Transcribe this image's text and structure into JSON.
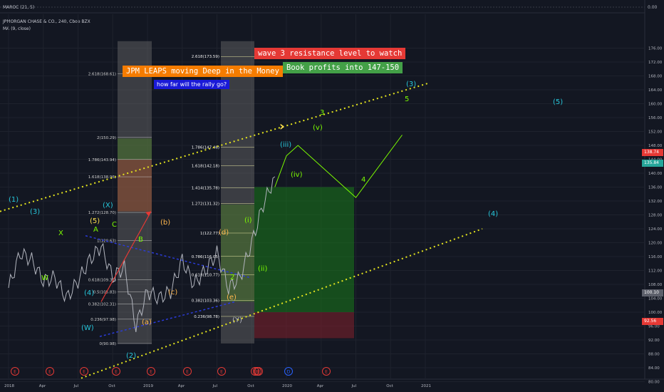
{
  "header": {
    "maroc": "MAROC (21, 5)",
    "symbol": "JPMORGAN CHASE & CO., 240, Cboe BZX",
    "ma": "MA (9, close)"
  },
  "annotations": {
    "wave3": "wave 3 resistance level to watch",
    "book": "Book profits into 147-150",
    "leaps": "JPM LEAPS moving Deep in the Money",
    "rally": "how far will the rally go?"
  },
  "price_tags": {
    "last": "138.74",
    "ma": "135.84",
    "stop": "100.10",
    "low": "92.56"
  },
  "colors": {
    "background": "#131722",
    "price_line": "#b2b5be",
    "channel": "#e6e61e",
    "wave_labels": "#26c6da",
    "projection": "#7cfc00",
    "long_position": "#1a7a1a",
    "stop_zone": "#7a1f2b"
  },
  "chart_data": {
    "type": "line",
    "title": "JPMORGAN CHASE & CO., 240, Cboe BZX",
    "indicator_title": "MAROC (21, 5)",
    "indicator_value_label": "0.00",
    "grid": true,
    "x_ticks": [
      "2018",
      "Apr",
      "Jul",
      "Oct",
      "2019",
      "Apr",
      "Jul",
      "Oct",
      "2020",
      "Apr",
      "Jul",
      "Oct",
      "2021"
    ],
    "y_ticks": [
      80,
      84,
      88,
      92,
      96,
      100,
      104,
      108,
      112,
      116,
      120,
      124,
      128,
      132,
      136,
      140,
      144,
      148,
      152,
      156,
      160,
      164,
      168,
      172,
      176
    ],
    "ylim": [
      78,
      178
    ],
    "series": [
      {
        "name": "price",
        "x": [
          "2018-01",
          "2018-02",
          "2018-03",
          "2018-04",
          "2018-05",
          "2018-06",
          "2018-07",
          "2018-08",
          "2018-09",
          "2018-10",
          "2018-11",
          "2018-12",
          "2019-01",
          "2019-02",
          "2019-03",
          "2019-04",
          "2019-05",
          "2019-06",
          "2019-07",
          "2019-08",
          "2019-09",
          "2019-10",
          "2019-11",
          "2019-12"
        ],
        "values": [
          107,
          117,
          115,
          109,
          110,
          104,
          109,
          115,
          119,
          110,
          113,
          96,
          106,
          104,
          106,
          115,
          108,
          112,
          117,
          107,
          110,
          120,
          131,
          139
        ]
      },
      {
        "name": "wave_projection",
        "x": [
          "2019-12",
          "2020-01",
          "2020-02",
          "2020-07",
          "2020-11"
        ],
        "values": [
          136,
          145,
          148,
          133,
          151
        ]
      }
    ],
    "fib_left": [
      "2.618(168.61)",
      "2(150.29)",
      "1.786(143.94)",
      "1.618(138.96)",
      "1.272(128.70)",
      "1(120.63)",
      "0.618(109.31)",
      "0.5(105.83)",
      "0.382(102.31)",
      "0.236(97.98)",
      "0(90.98)"
    ],
    "fib_right": [
      "2.618(173.59)",
      "1.786(147.46)",
      "1.618(142.18)",
      "1.414(135.78)",
      "1.272(131.32)",
      "1(122.77)",
      "0.786(116.05)",
      "0.618(110.77)",
      "0.382(103.36)",
      "0.236(98.78)"
    ],
    "wave_labels": [
      "(1)",
      "(3)",
      "X",
      "W",
      "(5)",
      "(X)",
      "A",
      "B",
      "C",
      "(4)",
      "(W)",
      "(2)",
      "(b)",
      "(c)",
      "(a)",
      "(d)",
      "(e)",
      "(Y)",
      "(i)",
      "(ii)",
      "(iii)",
      "(iv)",
      "(v)",
      "3",
      "4",
      "5",
      "(3)",
      "(5)",
      "(4)",
      "2"
    ],
    "events_row": [
      "E",
      "E",
      "E",
      "E",
      "E",
      "E",
      "E",
      "E",
      "E",
      "E",
      "D",
      "E"
    ]
  }
}
